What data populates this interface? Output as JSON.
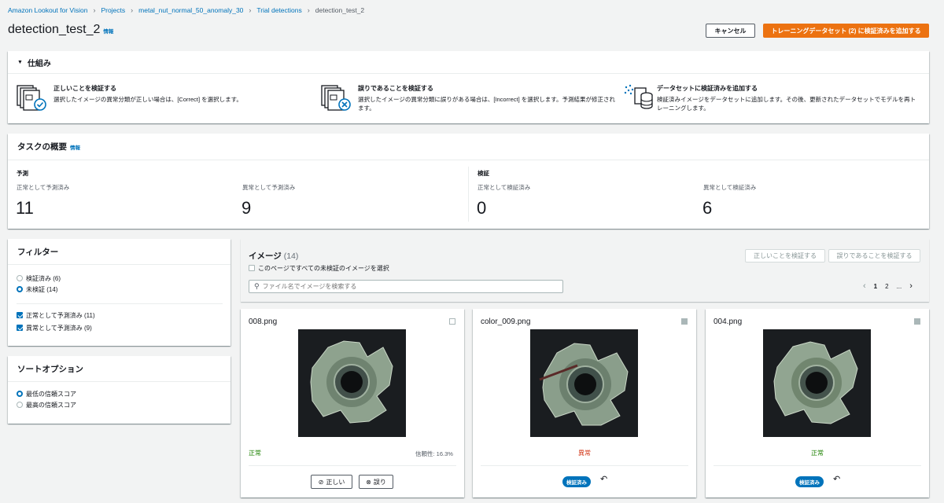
{
  "breadcrumb": {
    "items": [
      "Amazon Lookout for Vision",
      "Projects",
      "metal_nut_normal_50_anomaly_30",
      "Trial detections"
    ],
    "current": "detection_test_2"
  },
  "header": {
    "title": "detection_test_2",
    "info": "情報",
    "cancel_label": "キャンセル",
    "add_label": "トレーニングデータセット (2) に検証済みを追加する"
  },
  "how_it_works": {
    "title": "仕組み",
    "items": [
      {
        "title": "正しいことを検証する",
        "desc": "選択したイメージの異常分類が正しい場合は、[Correct] を選択します。"
      },
      {
        "title": "誤りであることを検証する",
        "desc": "選択したイメージの異常分類に誤りがある場合は、[Incorrect] を選択します。予測結果が修正されます。"
      },
      {
        "title": "データセットに検証済みを追加する",
        "desc": "検証済みイメージをデータセットに追加します。その後、更新されたデータセットでモデルを再トレーニングします。"
      }
    ]
  },
  "summary": {
    "title": "タスクの概要",
    "info": "情報",
    "prediction_label": "予測",
    "verification_label": "検証",
    "stats": [
      {
        "label": "正常として予測済み",
        "value": "11"
      },
      {
        "label": "異常として予測済み",
        "value": "9"
      },
      {
        "label": "正常として検証済み",
        "value": "0"
      },
      {
        "label": "異常として検証済み",
        "value": "6"
      }
    ]
  },
  "filter": {
    "title": "フィルター",
    "verified": "検証済み (6)",
    "unverified": "未検証 (14)",
    "pred_normal": "正常として予測済み (11)",
    "pred_anomaly": "異常として予測済み (9)"
  },
  "sort": {
    "title": "ソートオプション",
    "lowest": "最低の信頼スコア",
    "highest": "最高の信頼スコア"
  },
  "images": {
    "title": "イメージ",
    "count": "(14)",
    "select_all": "このページですべての未検証のイメージを選択",
    "search_placeholder": "ファイル名でイメージを検索する",
    "verify_correct": "正しいことを検証する",
    "verify_incorrect": "誤りであることを検証する",
    "pages": [
      "1",
      "2",
      "..."
    ],
    "cards": [
      {
        "name": "008.png",
        "label": "正常",
        "confidence": "信頼性: 16.3%",
        "correct_btn": "正しい",
        "wrong_btn": "誤り"
      },
      {
        "name": "color_009.png",
        "label": "異常",
        "badge": "検証済み"
      },
      {
        "name": "004.png",
        "label": "正常",
        "badge": "検証済み"
      }
    ]
  },
  "colors": {
    "accent": "#0073bb",
    "primary_button": "#ec7211",
    "normal": "#1d8102",
    "anomaly": "#d13212"
  }
}
